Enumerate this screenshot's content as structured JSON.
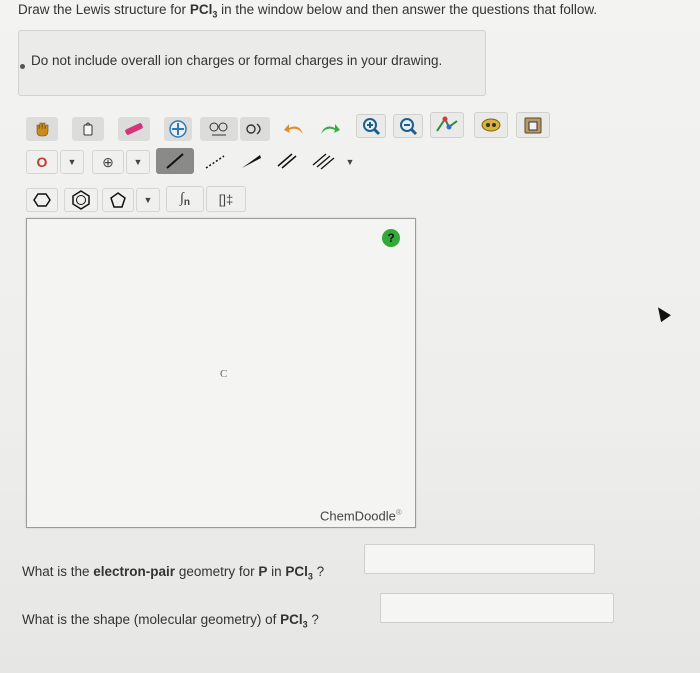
{
  "header": {
    "title_pre": "Draw the Lewis structure for ",
    "title_formula": "PCl",
    "title_sub": "3",
    "title_post": " in the window below and then answer the questions that follow."
  },
  "note": {
    "text": "Do not include overall ion charges or formal charges in your drawing."
  },
  "toolbar": {
    "row1": [
      "hand-tool-icon",
      "lasso-icon",
      "eraser-icon",
      "template-icon",
      "clean-icon",
      "ring-icon",
      "undo-icon",
      "redo-icon",
      "zoom-in-icon",
      "zoom-out-icon",
      "center-icon",
      "copy-icon",
      "paste-icon"
    ],
    "row2": {
      "atom_label": "O",
      "charge_label": "⊕",
      "bracket_text": "n"
    },
    "row3": {
      "brackets_label": "[]‡"
    }
  },
  "canvas": {
    "atom": "C",
    "help": "?",
    "brand": "ChemDoodle",
    "brand_mark": "®"
  },
  "questions": [
    {
      "pre": "What is the ",
      "bold": "electron-pair",
      "mid": " geometry for ",
      "bold2": "P",
      "mid2": " in ",
      "formula": "PCl",
      "sub": "3",
      "post": " ?",
      "value": ""
    },
    {
      "pre": "What is the shape (molecular geometry) of ",
      "formula": "PCl",
      "sub": "3",
      "post": " ?",
      "value": ""
    }
  ]
}
